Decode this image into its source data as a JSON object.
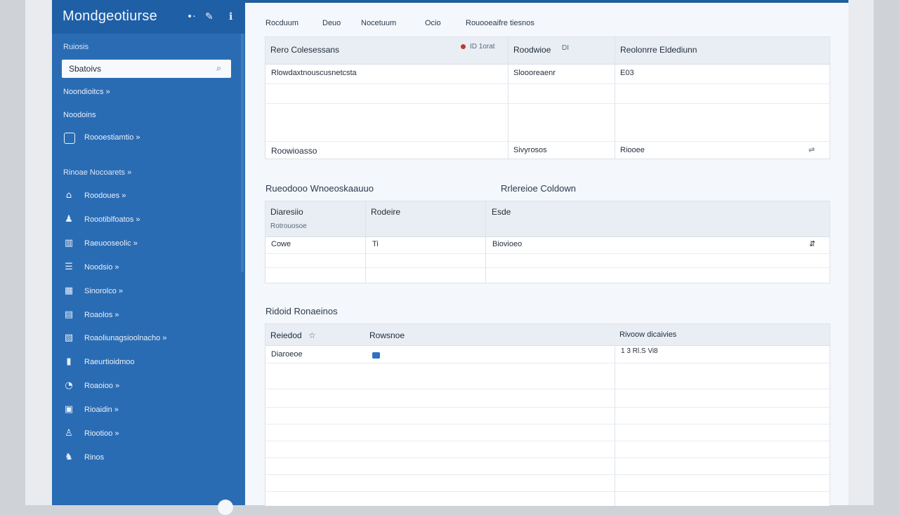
{
  "app": {
    "title": "Mondgeotiurse",
    "header_icons": [
      "more-dots-icon",
      "edit-icon",
      "info-icon"
    ]
  },
  "sidebar": {
    "section_label": "Ruiosis",
    "search": {
      "value": "Sbatoivs",
      "icon": "search-icon"
    },
    "items_top": [
      {
        "label": "Noondioitcs »"
      },
      {
        "label": "Noodoins"
      },
      {
        "label": "Roooestiamtio »",
        "icon": "boxed-square-icon"
      }
    ],
    "group_label": "Rinoae Nocoarets »",
    "items": [
      {
        "label": "Roodoues »",
        "icon": "home-icon"
      },
      {
        "label": "Roootiblfoatos »",
        "icon": "users-icon"
      },
      {
        "label": "Raeuooseolic »",
        "icon": "chart-icon"
      },
      {
        "label": "Noodsio »",
        "icon": "list-icon"
      },
      {
        "label": "Sinorolco »",
        "icon": "grid-icon"
      },
      {
        "label": "Roaolos »",
        "icon": "folder-icon"
      },
      {
        "label": "Roaoliunagsioolnacho »",
        "icon": "table-icon"
      },
      {
        "label": "Raeurtioidmoo",
        "icon": "bars-icon"
      },
      {
        "label": "Roaoioo »",
        "icon": "pie-icon"
      },
      {
        "label": "Rioaidin »",
        "icon": "doc-icon"
      },
      {
        "label": "Riootioo »",
        "icon": "user-icon"
      },
      {
        "label": "Rinos",
        "icon": "tag-icon"
      }
    ]
  },
  "main": {
    "tabs": [
      "Rocduum",
      "Deuo",
      "Nocetuum",
      "Ocio",
      "Rouooeaifre tiesnos"
    ],
    "table1": {
      "headers": [
        "Rero Colesessans",
        "Roodwioe",
        "Reolonrre Eldediunn"
      ],
      "header_meta": "ID  1orat",
      "header_meta2": "DI",
      "rows": [
        [
          "Rlowdaxtnouscusnetcsta",
          "Sloooreaenr",
          "E03"
        ],
        [
          "Roowioasso",
          "Sivyrosos",
          "Riooee"
        ]
      ],
      "row_action_icon": "sort-icon"
    },
    "section2": {
      "title": "Rueodooo Wnoeoskaauuo",
      "title_right": "Rrlereioe Coldown"
    },
    "table2": {
      "headers": [
        "Diaresiio",
        "Rodeire",
        "Esde"
      ],
      "subheader": "Rotrouosoe",
      "rows": [
        [
          "Cowe",
          "Ti",
          "Biovioeo"
        ]
      ],
      "row_action_icon": "expand-icon"
    },
    "section3": {
      "title": "Ridoid Ronaeinos"
    },
    "table3": {
      "headers": [
        "Reiedod",
        "Rowsnoe",
        "Rivoow dicaivies"
      ],
      "header_marker": "☆",
      "rows": [
        [
          "Diaroeoe",
          "",
          "1 3 Rl.S Vi8"
        ]
      ],
      "row_icon": "comment-icon"
    }
  },
  "colors": {
    "sidebar": "#2a6cb3",
    "sidebar_header": "#1f5fa6",
    "accent": "#1f5f9e",
    "panel_header": "#e9eef4",
    "background": "#f4f7fb"
  }
}
